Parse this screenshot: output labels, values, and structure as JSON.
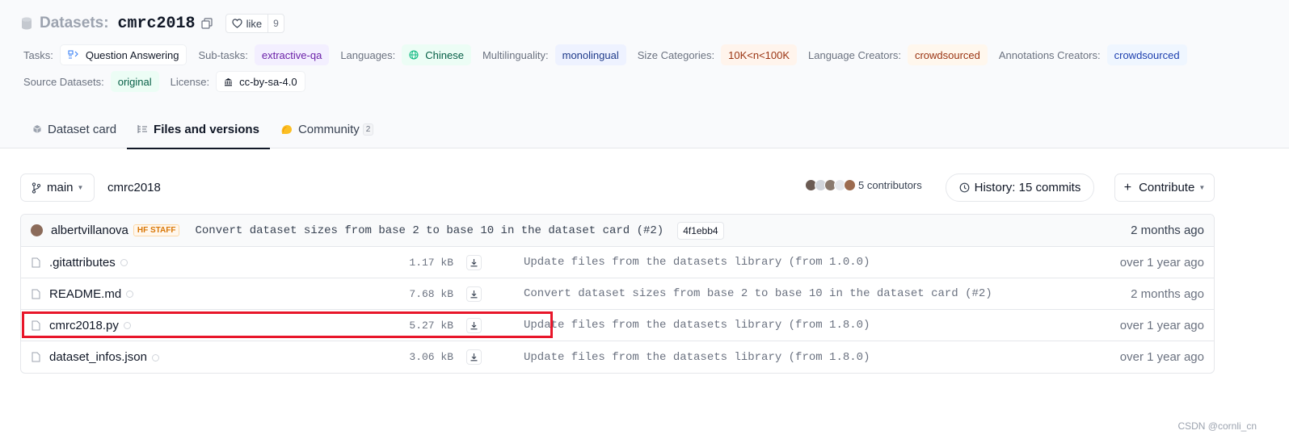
{
  "header": {
    "kind": "Datasets:",
    "repo_name": "cmrc2018",
    "like_label": "like",
    "like_count": "9"
  },
  "tags": {
    "tasks_label": "Tasks:",
    "tasks_value": "Question Answering",
    "subtasks_label": "Sub-tasks:",
    "subtasks_value": "extractive-qa",
    "languages_label": "Languages:",
    "languages_value": "Chinese",
    "multilinguality_label": "Multilinguality:",
    "multilinguality_value": "monolingual",
    "size_label": "Size Categories:",
    "size_value": "10K<n<100K",
    "lang_creators_label": "Language Creators:",
    "lang_creators_value": "crowdsourced",
    "ann_creators_label": "Annotations Creators:",
    "ann_creators_value": "crowdsourced",
    "source_label": "Source Datasets:",
    "source_value": "original",
    "license_label": "License:",
    "license_value": "cc-by-sa-4.0"
  },
  "tabs": [
    {
      "label": "Dataset card",
      "icon": "cube-icon"
    },
    {
      "label": "Files and versions",
      "icon": "files-icon"
    },
    {
      "label": "Community",
      "icon": "community-icon",
      "badge": "2"
    }
  ],
  "toolbar": {
    "branch": "main",
    "path": "cmrc2018",
    "contributors": "5 contributors",
    "history": "History: 15 commits",
    "contribute": "Contribute"
  },
  "last_commit": {
    "author": "albertvillanova",
    "badge": "HF STAFF",
    "message": "Convert dataset sizes from base 2 to base 10 in the dataset card (#2)",
    "hash": "4f1ebb4",
    "date": "2 months ago"
  },
  "files": [
    {
      "name": ".gitattributes",
      "size": "1.17 kB",
      "commit": "Update files from the datasets library (from 1.0.0)",
      "date": "over 1 year ago"
    },
    {
      "name": "README.md",
      "size": "7.68 kB",
      "commit": "Convert dataset sizes from base 2 to base 10 in the dataset card (#2)",
      "date": "2 months ago"
    },
    {
      "name": "cmrc2018.py",
      "size": "5.27 kB",
      "commit": "Update files from the datasets library (from 1.8.0)",
      "date": "over 1 year ago"
    },
    {
      "name": "dataset_infos.json",
      "size": "3.06 kB",
      "commit": "Update files from the datasets library (from 1.8.0)",
      "date": "over 1 year ago"
    }
  ],
  "colors": {
    "highlight": "#e8162a",
    "staff_badge": "#d97706"
  },
  "watermark": "CSDN @cornli_cn"
}
